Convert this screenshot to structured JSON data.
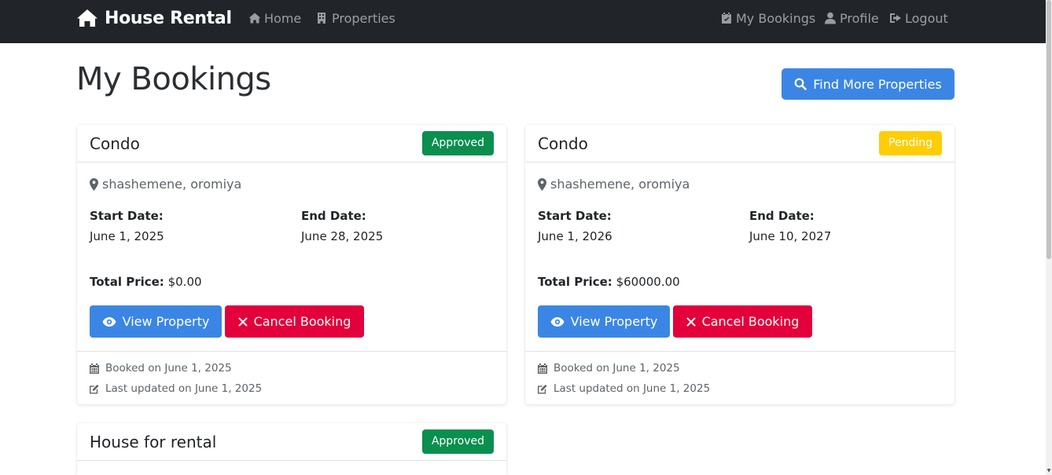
{
  "nav": {
    "brand": "House Rental",
    "home": "Home",
    "properties": "Properties",
    "my_bookings": "My Bookings",
    "profile": "Profile",
    "logout": "Logout"
  },
  "page": {
    "title": "My Bookings",
    "find_button": "Find More Properties"
  },
  "labels": {
    "start_date": "Start Date:",
    "end_date": "End Date:",
    "total_price": "Total Price:",
    "view_property": "View Property",
    "cancel_booking": "Cancel Booking"
  },
  "bookings": [
    {
      "title": "Condo",
      "status": "Approved",
      "location": "shashemene, oromiya",
      "start_date": "June 1, 2025",
      "end_date": "June 28, 2025",
      "total_price": "$0.00",
      "booked_on": "Booked on June 1, 2025",
      "updated_on": "Last updated on June 1, 2025"
    },
    {
      "title": "Condo",
      "status": "Pending",
      "location": "shashemene, oromiya",
      "start_date": "June 1, 2026",
      "end_date": "June 10, 2027",
      "total_price": "$60000.00",
      "booked_on": "Booked on June 1, 2025",
      "updated_on": "Last updated on June 1, 2025"
    },
    {
      "title": "House for rental",
      "status": "Approved"
    }
  ],
  "colors": {
    "navbar": "#212529",
    "primary": "#3b86e4",
    "danger": "#e4003a",
    "success": "#0a8f4e",
    "warning": "#ffcd06"
  },
  "icons": {
    "brand": "house-icon",
    "home": "home-icon",
    "properties": "building-icon",
    "my_bookings": "calendar-check-icon",
    "profile": "user-icon",
    "logout": "sign-out-icon",
    "find": "search-icon",
    "location": "map-marker-icon",
    "view": "eye-icon",
    "cancel": "x-icon",
    "booked": "calendar-icon",
    "updated": "edit-icon"
  }
}
